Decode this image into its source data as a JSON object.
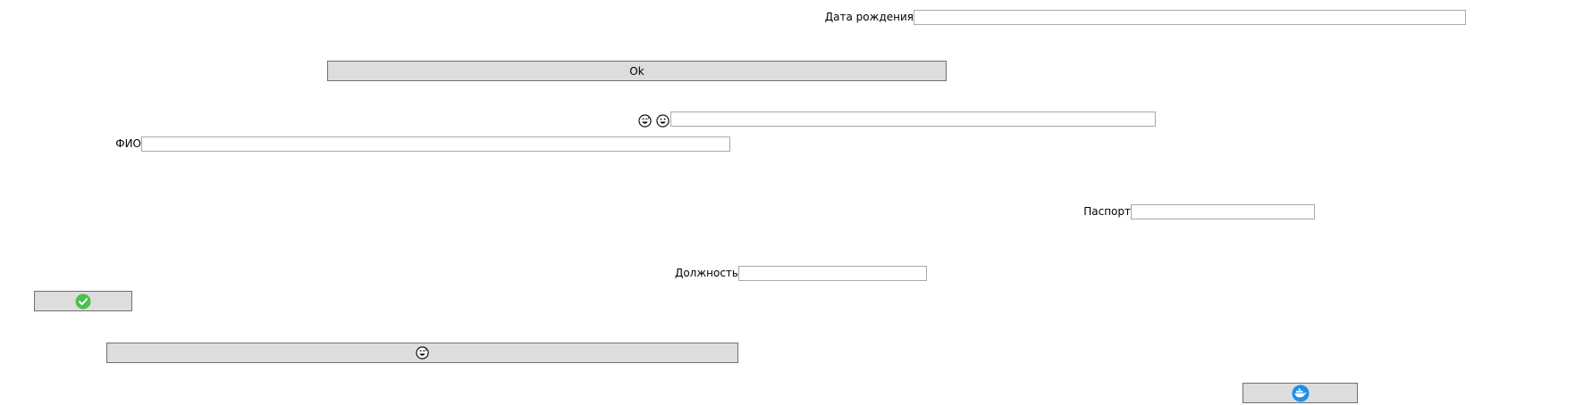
{
  "form": {
    "birth_date_label": "Дата рождения",
    "birth_date_value": "",
    "ok_button_label": "Ok",
    "emoji_field_value": "",
    "fio_label": "ФИО",
    "fio_value": "",
    "passport_label": "Паспорт",
    "passport_value": "",
    "position_label": "Должность",
    "position_value": ""
  },
  "icons": {
    "emoji_1": "grinning-sweat-face-icon",
    "emoji_2": "grinning-face-icon",
    "confirm": "check-circle-icon",
    "emoji_button": "grinning-sweat-face-icon",
    "docker": "docker-whale-icon"
  },
  "colors": {
    "button_bg": "#dddddd",
    "button_border": "#707070",
    "field_border": "#a9a9a9",
    "check_green": "#4cc04c",
    "docker_blue": "#1d91e6"
  }
}
